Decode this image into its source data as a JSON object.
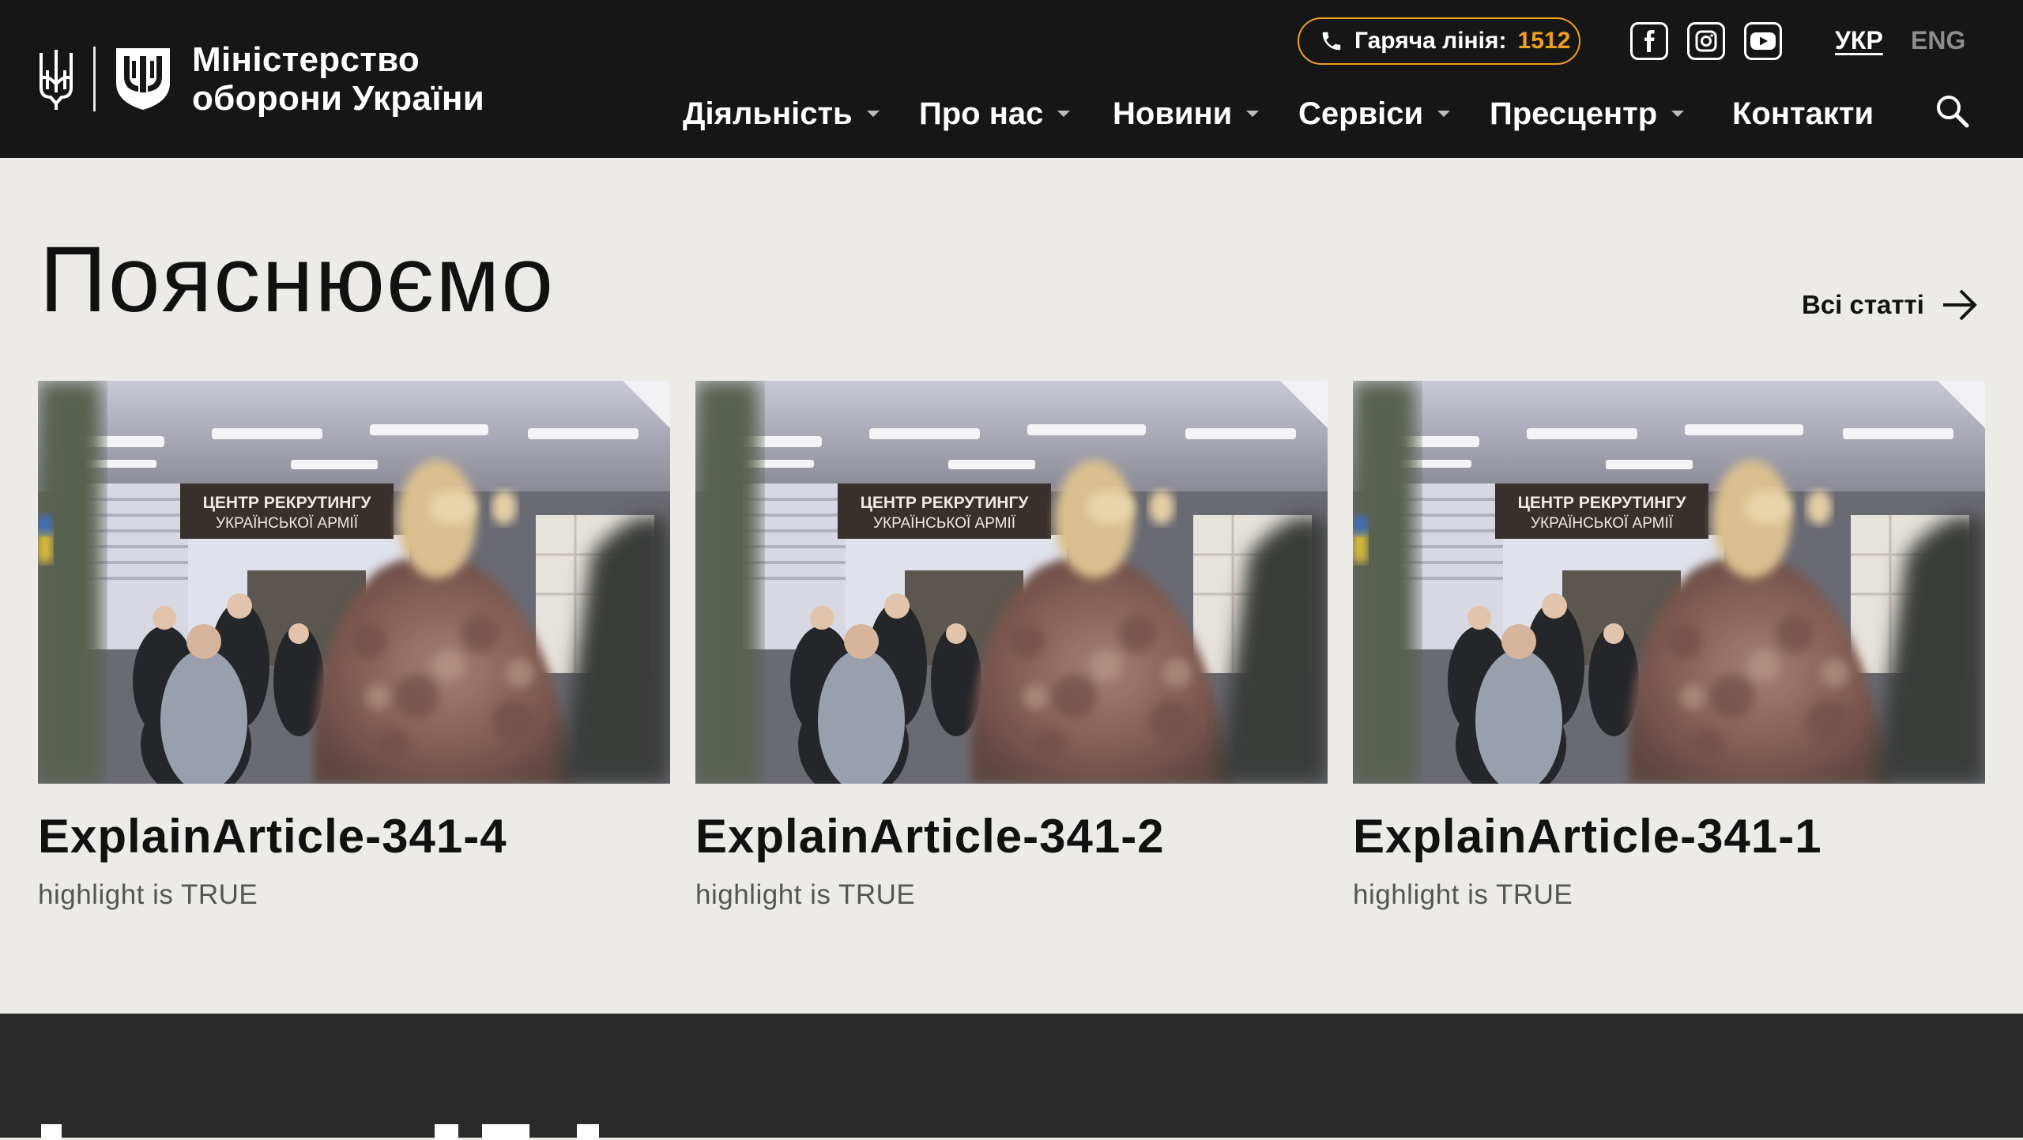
{
  "header": {
    "brand_line1": "Міністерство",
    "brand_line2": "оборони України",
    "hotline_label": "Гаряча лінія:",
    "hotline_number": "1512",
    "languages": [
      {
        "label": "УКР",
        "active": true
      },
      {
        "label": "ENG",
        "active": false
      }
    ],
    "social_icons": [
      "facebook-icon",
      "instagram-icon",
      "youtube-icon"
    ],
    "nav": [
      {
        "label": "Діяльність",
        "has_dropdown": true
      },
      {
        "label": "Про нас",
        "has_dropdown": true
      },
      {
        "label": "Новини",
        "has_dropdown": true
      },
      {
        "label": "Сервіси",
        "has_dropdown": true
      },
      {
        "label": "Пресцентр",
        "has_dropdown": true
      },
      {
        "label": "Контакти",
        "has_dropdown": false
      }
    ]
  },
  "section": {
    "title": "Пояснюємо",
    "all_link": "Всі статті"
  },
  "cards": [
    {
      "title": "ExplainArticle-341-4",
      "subtitle": "highlight is TRUE",
      "banner_line1": "ЦЕНТР РЕКРУТИНГУ",
      "banner_line2": "УКРАЇНСЬКОЇ АРМІЇ"
    },
    {
      "title": "ExplainArticle-341-2",
      "subtitle": "highlight is TRUE",
      "banner_line1": "ЦЕНТР РЕКРУТИНГУ",
      "banner_line2": "УКРАЇНСЬКОЇ АРМІЇ"
    },
    {
      "title": "ExplainArticle-341-1",
      "subtitle": "highlight is TRUE",
      "banner_line1": "ЦЕНТР РЕКРУТИНГУ",
      "banner_line2": "УКРАЇНСЬКОЇ АРМІЇ"
    }
  ],
  "colors": {
    "header_bg": "#161616",
    "page_bg": "#ecebe7",
    "accent": "#f0a11d",
    "footer_band": "#2a2a2a"
  }
}
